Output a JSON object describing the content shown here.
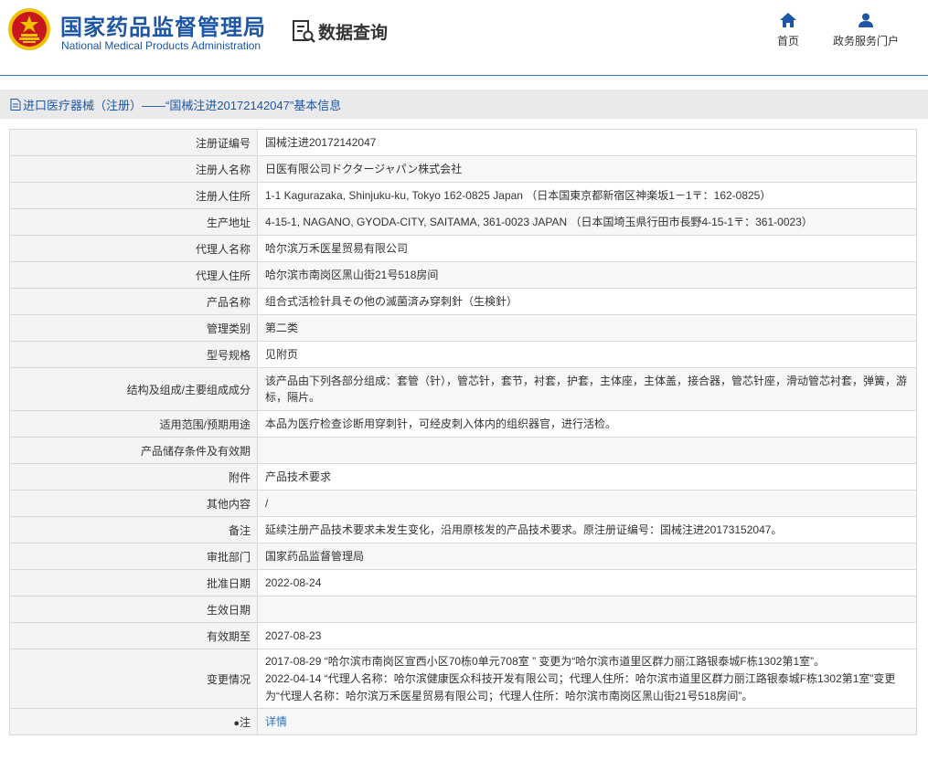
{
  "header": {
    "brand_cn": "国家药品监督管理局",
    "brand_en": "National Medical Products Administration",
    "query_title": "数据查询",
    "nav": [
      {
        "label": "首页",
        "icon": "home-icon"
      },
      {
        "label": "政务服务门户",
        "icon": "user-icon"
      }
    ]
  },
  "section": {
    "title": "进口医疗器械（注册）——“国械注进20172142047”基本信息"
  },
  "colors": {
    "brand_blue": "#1d56a6",
    "link_blue": "#2d74b9",
    "seal_red": "#c8161d",
    "seal_gold": "#f2c200"
  },
  "rows": [
    {
      "label": "注册证编号",
      "value": "国械注进20172142047"
    },
    {
      "label": "注册人名称",
      "value": "日医有限公司ドクタージャパン株式会社"
    },
    {
      "label": "注册人住所",
      "value": "1-1 Kagurazaka, Shinjuku-ku, Tokyo 162-0825 Japan （日本国東京都新宿区神楽坂1－1〒：162-0825）"
    },
    {
      "label": "生产地址",
      "value": "4-15-1, NAGANO, GYODA-CITY, SAITAMA, 361-0023 JAPAN （日本国埼玉県行田市長野4-15-1〒：361-0023）"
    },
    {
      "label": "代理人名称",
      "value": "哈尔滨万禾医星贸易有限公司"
    },
    {
      "label": "代理人住所",
      "value": "哈尔滨市南岗区黑山街21号518房间"
    },
    {
      "label": "产品名称",
      "value": "组合式活检针具その他の滅菌済み穿刺針（生検針）"
    },
    {
      "label": "管理类别",
      "value": "第二类"
    },
    {
      "label": "型号规格",
      "value": "见附页"
    },
    {
      "label": "结构及组成/主要组成成分",
      "value": "该产品由下列各部分组成：套管（针），管芯针，套节，衬套，护套，主体座，主体盖，接合器，管芯针座，滑动管芯衬套，弹簧，游标，隔片。"
    },
    {
      "label": "适用范围/预期用途",
      "value": "本品为医疗检查诊断用穿刺针，可经皮刺入体内的组织器官，进行活检。"
    },
    {
      "label": "产品储存条件及有效期",
      "value": ""
    },
    {
      "label": "附件",
      "value": "产品技术要求"
    },
    {
      "label": "其他内容",
      "value": "/"
    },
    {
      "label": "备注",
      "value": "延续注册产品技术要求未发生变化，沿用原核发的产品技术要求。原注册证编号：国械注进20173152047。"
    },
    {
      "label": "审批部门",
      "value": "国家药品监督管理局"
    },
    {
      "label": "批准日期",
      "value": "2022-08-24"
    },
    {
      "label": "生效日期",
      "value": ""
    },
    {
      "label": "有效期至",
      "value": "2027-08-23"
    }
  ],
  "changes": {
    "label": "变更情况",
    "lines": [
      "2017-08-29 “哈尔滨市南岗区宣西小区70栋0单元708室 ” 变更为“哈尔滨市道里区群力丽江路银泰城F栋1302第1室”。",
      "2022-04-14 “代理人名称：哈尔滨健康医众科技开发有限公司；代理人住所：哈尔滨市道里区群力丽江路银泰城F栋1302第1室”变更为“代理人名称：哈尔滨万禾医星贸易有限公司；代理人住所：哈尔滨市南岗区黑山街21号518房间”。"
    ]
  },
  "note": {
    "label": "注",
    "pin_icon": "●",
    "link_text": "详情"
  }
}
